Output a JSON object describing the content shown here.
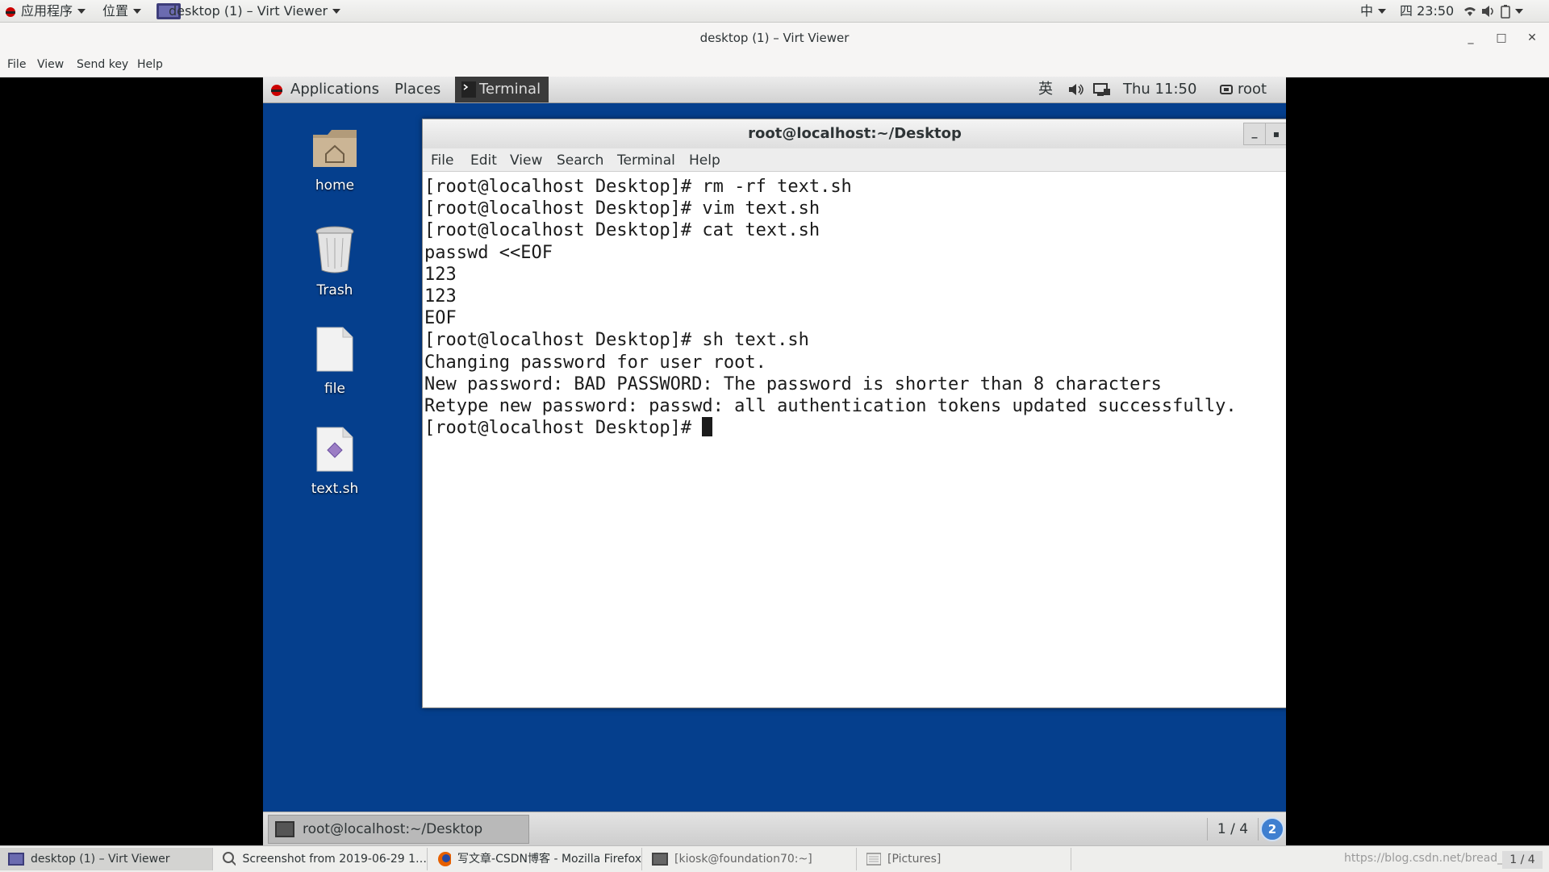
{
  "host_panel": {
    "apps_label": "应用程序",
    "places_label": "位置",
    "window_label": "desktop (1) – Virt Viewer",
    "input_method": "中",
    "clock": "四 23:50"
  },
  "virt_viewer": {
    "title": "desktop (1) – Virt Viewer",
    "menu": [
      "File",
      "View",
      "Send key",
      "Help"
    ]
  },
  "guest": {
    "panel": {
      "applications": "Applications",
      "places": "Places",
      "terminal": "Terminal",
      "input_method": "英",
      "clock": "Thu 11:50",
      "user": "root"
    },
    "desktop_icons": [
      "home",
      "Trash",
      "file",
      "text.sh"
    ],
    "terminal": {
      "title": "root@localhost:~/Desktop",
      "menu": [
        "File",
        "Edit",
        "View",
        "Search",
        "Terminal",
        "Help"
      ],
      "lines": [
        "[root@localhost Desktop]# rm -rf text.sh",
        "[root@localhost Desktop]# vim text.sh",
        "[root@localhost Desktop]# cat text.sh",
        "passwd <<EOF",
        "123",
        "123",
        "EOF",
        "[root@localhost Desktop]# sh text.sh",
        "Changing password for user root.",
        "New password: BAD PASSWORD: The password is shorter than 8 characters",
        "Retype new password: passwd: all authentication tokens updated successfully.",
        "[root@localhost Desktop]# "
      ]
    },
    "bottom_panel": {
      "task": "root@localhost:~/Desktop",
      "workspace": "1 / 4",
      "badge": "2"
    }
  },
  "host_taskbar": {
    "tasks": [
      "desktop (1) – Virt Viewer",
      "Screenshot from 2019-06-29 1…",
      "写文章-CSDN博客 - Mozilla Firefox",
      "[kiosk@foundation70:~]",
      "[Pictures]"
    ],
    "watermark": "https://blog.csdn.net/bread_w",
    "workspace": "1 / 4"
  }
}
